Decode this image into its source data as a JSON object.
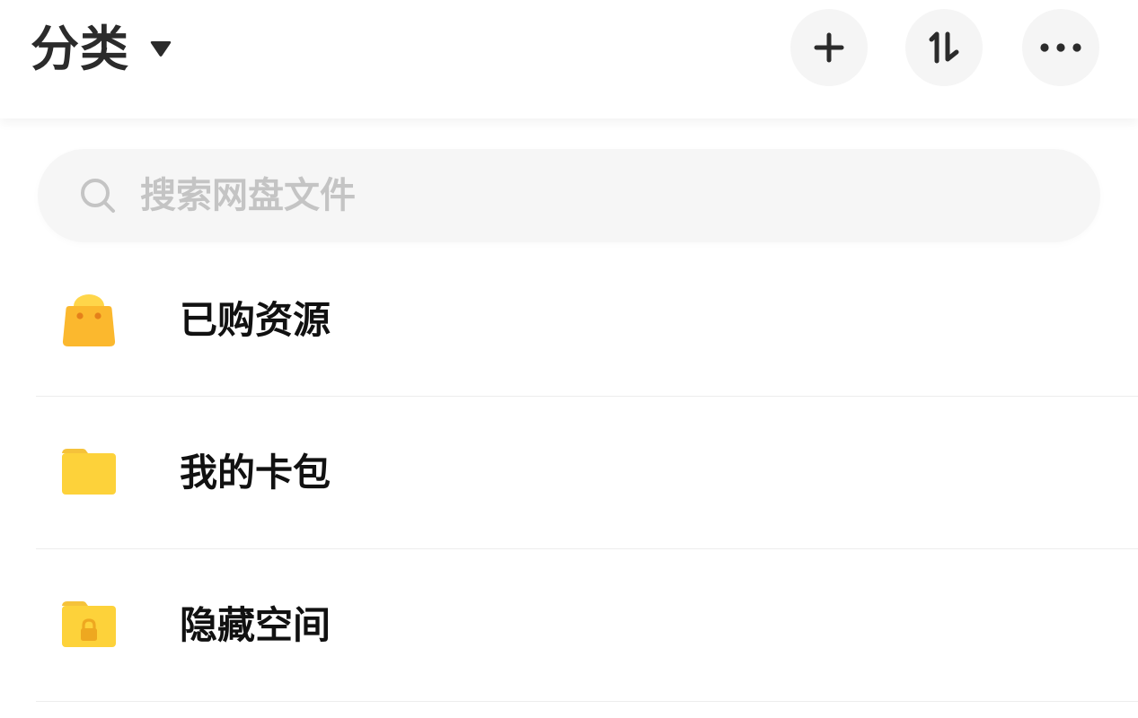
{
  "header": {
    "title": "分类",
    "actions": [
      {
        "name": "add",
        "icon": "plus-icon"
      },
      {
        "name": "sort",
        "icon": "sort-icon"
      },
      {
        "name": "more",
        "icon": "more-dots-icon"
      }
    ]
  },
  "search": {
    "placeholder": "搜索网盘文件",
    "value": "",
    "icon": "search-icon"
  },
  "categories": [
    {
      "label": "已购资源",
      "icon": "shopping-bag-icon",
      "color": "#FBB82E"
    },
    {
      "label": "我的卡包",
      "icon": "folder-icon",
      "color": "#FDD23A"
    },
    {
      "label": "隐藏空间",
      "icon": "locked-folder-icon",
      "color": "#FDD23A"
    }
  ],
  "colors": {
    "title": "#2B2B2B",
    "button_bg": "#F5F5F5",
    "search_bg": "#F6F6F6",
    "placeholder": "#C4C4C4",
    "item_text": "#111111",
    "divider": "#EDEDED"
  }
}
